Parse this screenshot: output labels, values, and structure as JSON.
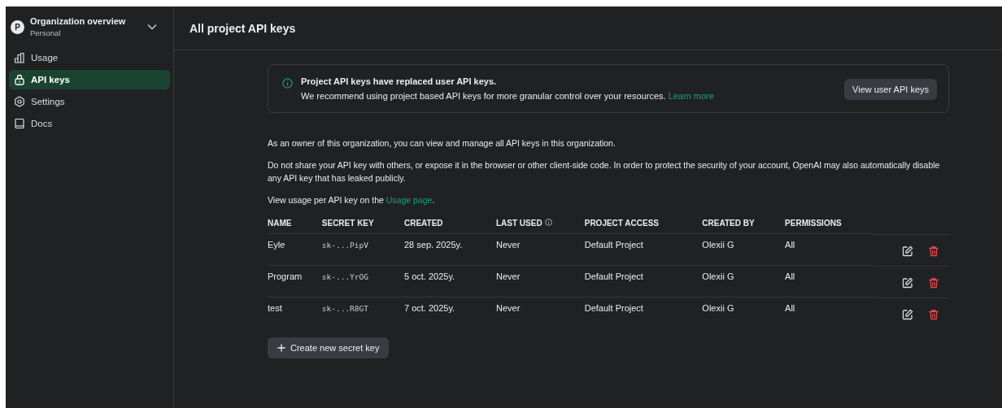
{
  "org": {
    "avatar": "P",
    "title": "Organization overview",
    "subtitle": "Personal"
  },
  "nav": [
    {
      "label": "Usage",
      "kind": "usage",
      "selected": false
    },
    {
      "label": "API keys",
      "kind": "keys",
      "selected": true
    },
    {
      "label": "Settings",
      "kind": "settings",
      "selected": false
    },
    {
      "label": "Docs",
      "kind": "docs",
      "selected": false
    }
  ],
  "header": {
    "title": "All project API keys"
  },
  "notice": {
    "title": "Project API keys have replaced user API keys.",
    "text": "We recommend using project based API keys for more granular control over your resources.",
    "link": "Learn more",
    "button": "View user API keys"
  },
  "intro": [
    "As an owner of this organization, you can view and manage all API keys in this organization.",
    "Do not share your API key with others, or expose it in the browser or other client-side code. In order to protect the security of your account, OpenAI may also automatically disable any API key that has leaked publicly."
  ],
  "usage_line": {
    "before": "View usage per API key on the",
    "link": "Usage page",
    "after": "."
  },
  "table": {
    "columns": [
      {
        "label": "NAME",
        "info": false
      },
      {
        "label": "SECRET KEY",
        "info": false
      },
      {
        "label": "CREATED",
        "info": false
      },
      {
        "label": "LAST USED",
        "info": true
      },
      {
        "label": "PROJECT ACCESS",
        "info": false
      },
      {
        "label": "CREATED BY",
        "info": false
      },
      {
        "label": "PERMISSIONS",
        "info": false
      }
    ],
    "rows": [
      [
        "Eyle",
        "sk-...PipV",
        "28 sep. 2025y.",
        "Never",
        "Default Project",
        "Olexii G",
        "All"
      ],
      [
        "Program",
        "sk-...YrOG",
        "5 oct. 2025y.",
        "Never",
        "Default Project",
        "Olexii G",
        "All"
      ],
      [
        "test",
        "sk-...R8GT",
        "7 oct. 2025y.",
        "Never",
        "Default Project",
        "Olexii G",
        "All"
      ]
    ]
  },
  "create_button": "Create new secret key"
}
